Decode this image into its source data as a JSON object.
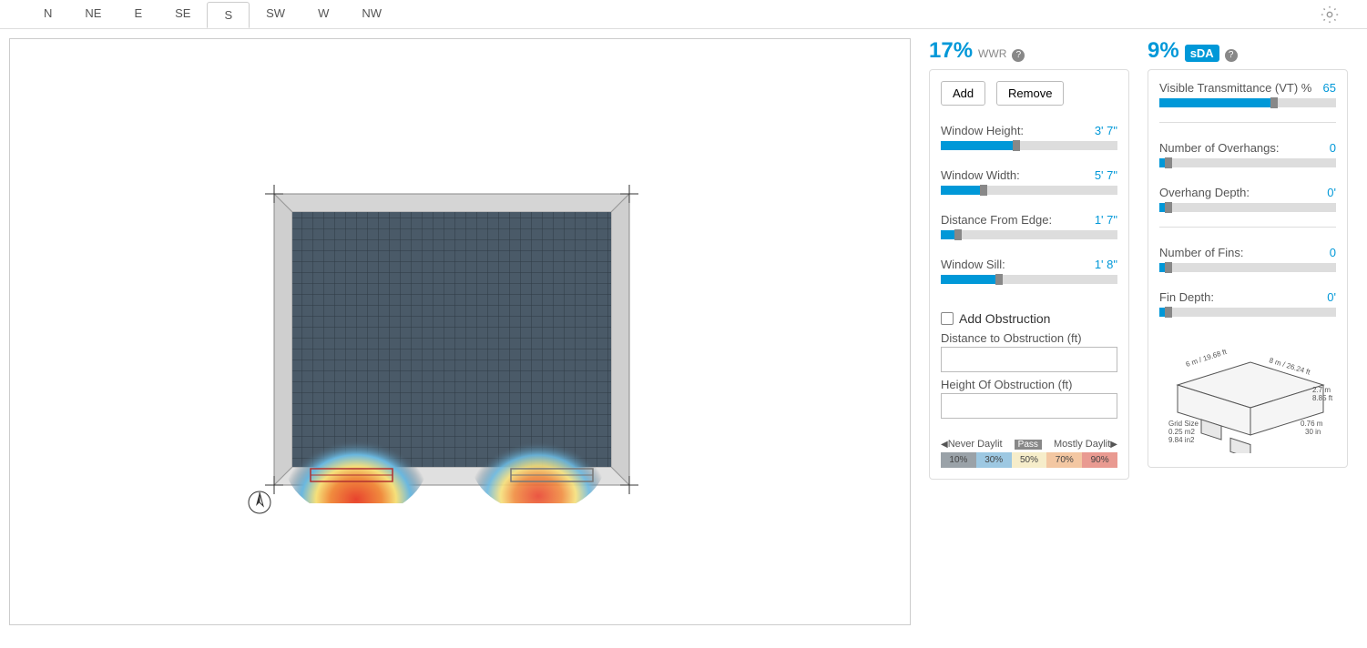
{
  "tabs": [
    "N",
    "NE",
    "E",
    "SE",
    "S",
    "SW",
    "W",
    "NW"
  ],
  "activeTab": "S",
  "wwr": {
    "value": "17%",
    "label": "WWR"
  },
  "sda": {
    "value": "9%",
    "label": "sDA"
  },
  "buttons": {
    "add": "Add",
    "remove": "Remove"
  },
  "sliders_wwr": [
    {
      "label": "Window Height:",
      "value": "3' 7\"",
      "pct": 43
    },
    {
      "label": "Window Width:",
      "value": "5' 7\"",
      "pct": 24
    },
    {
      "label": "Distance From Edge:",
      "value": "1' 7\"",
      "pct": 10
    },
    {
      "label": "Window Sill:",
      "value": "1' 8\"",
      "pct": 33
    }
  ],
  "obstruction": {
    "checkbox_label": "Add Obstruction",
    "dist_label": "Distance to Obstruction (ft)",
    "height_label": "Height Of Obstruction (ft)"
  },
  "legend": {
    "left": "Never Daylit",
    "mid": "Pass",
    "right": "Mostly Daylit",
    "cells": [
      {
        "txt": "10%",
        "bg": "#9aa2a8"
      },
      {
        "txt": "30%",
        "bg": "#9dc8e2"
      },
      {
        "txt": "50%",
        "bg": "#f6edca"
      },
      {
        "txt": "70%",
        "bg": "#f3c7a2"
      },
      {
        "txt": "90%",
        "bg": "#e99a91"
      }
    ]
  },
  "sliders_sda": [
    {
      "label": "Visible Transmittance (VT) %",
      "value": "65",
      "pct": 65
    },
    {
      "label": "Number of Overhangs:",
      "value": "0",
      "pct": 5
    },
    {
      "label": "Overhang Depth:",
      "value": "0'",
      "pct": 5
    },
    {
      "label": "Number of Fins:",
      "value": "0",
      "pct": 5
    },
    {
      "label": "Fin Depth:",
      "value": "0'",
      "pct": 5
    }
  ],
  "iso": {
    "dim_left": "6 m / 19.68 ft",
    "dim_right": "8 m / 26.24 ft",
    "dim_h1": "2.7 m",
    "dim_h2": "8.85 ft",
    "dim_b1": "0.76 m",
    "dim_b2": "30 in",
    "grid1": "Grid Size",
    "grid2": "0.25 m2",
    "grid3": "9.84 in2"
  }
}
